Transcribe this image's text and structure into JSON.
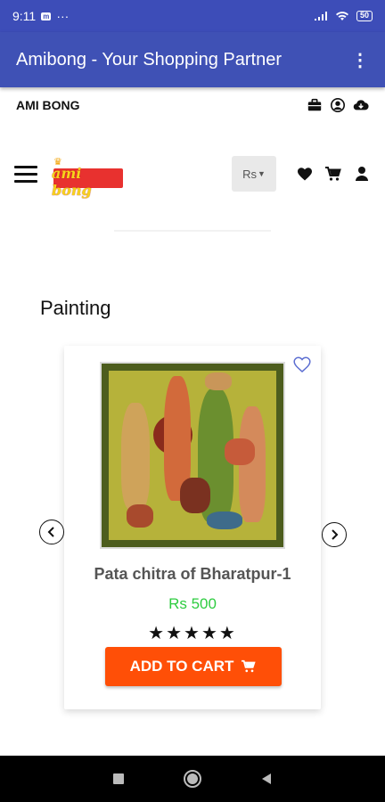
{
  "status_bar": {
    "time": "9:11",
    "notif_badge": "m",
    "dots": "···",
    "battery": "50"
  },
  "app_bar": {
    "title": "Amibong - Your Shopping Partner",
    "overflow_icon": "more-vert-icon"
  },
  "top_strip": {
    "brand": "AMI BONG",
    "icons": [
      "briefcase-icon",
      "user-circle-icon",
      "cloud-download-icon"
    ]
  },
  "nav": {
    "logo_text": "ami bong",
    "currency": "Rs",
    "icons": [
      "heart-icon",
      "cart-icon",
      "user-icon"
    ]
  },
  "section": {
    "title": "Painting"
  },
  "product": {
    "name": "Pata chitra of Bharatpur-1",
    "price": "Rs 500",
    "rating": 5,
    "stars": "★★★★★",
    "add_to_cart": "ADD TO CART"
  },
  "colors": {
    "primary": "#3f51b5",
    "cart_button": "#ff4f07",
    "price": "#2ecc40"
  }
}
